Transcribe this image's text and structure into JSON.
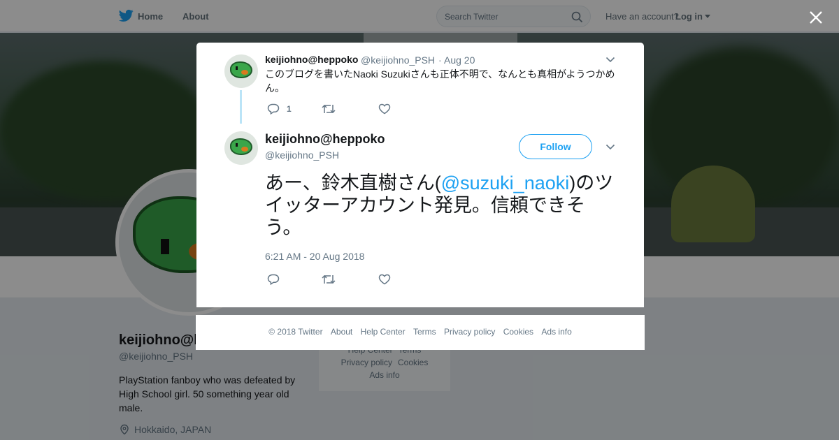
{
  "nav": {
    "home_label": "Home",
    "about_label": "About",
    "search_placeholder": "Search Twitter",
    "have_account": "Have an account?",
    "login_label": "Log in",
    "brand_color": "#1da1f2"
  },
  "profile": {
    "name": "keijiohno@heppoko",
    "handle": "@keijiohno_PSH",
    "bio": "PlayStation fanboy who was defeated by High School girl. 50 something year old male.",
    "location": "Hokkaido, JAPAN"
  },
  "side_links": [
    "Help Center",
    "Terms",
    "Privacy policy",
    "Cookies",
    "Ads info"
  ],
  "parent_tweet": {
    "name": "keijiohno@heppoko",
    "handle": "@keijiohno_PSH",
    "separator": "·",
    "date": "Aug 20",
    "text": "このブログを書いたNaoki Suzukiさんも正体不明で、なんとも真相がようつかめん。",
    "reply_count": "1"
  },
  "main_tweet": {
    "name": "keijiohno@heppoko",
    "handle": "@keijiohno_PSH",
    "follow_label": "Follow",
    "text_before": "あー、鈴木直樹さん(",
    "mention": "@suzuki_naoki",
    "text_after": ")のツイッターアカウント発見。信頼できそう。",
    "timestamp": "6:21 AM - 20 Aug 2018"
  },
  "footer": {
    "links": [
      "© 2018 Twitter",
      "About",
      "Help Center",
      "Terms",
      "Privacy policy",
      "Cookies",
      "Ads info"
    ]
  }
}
